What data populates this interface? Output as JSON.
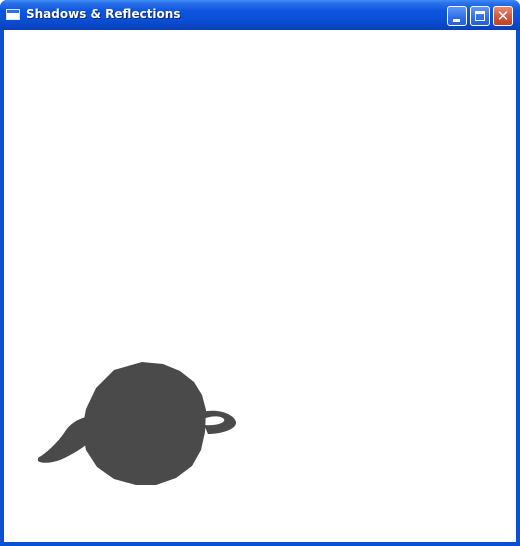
{
  "window": {
    "title": "Shadows & Reflections",
    "controls": {
      "minimize": "minimize-icon",
      "maximize": "maximize-icon",
      "close": "close-icon"
    },
    "app_icon": "window-icon"
  },
  "scene": {
    "background_color": "#ffffff",
    "object": "teapot-shadow",
    "shadow_color": "#4a4a4a"
  },
  "theme": {
    "titlebar_color": "#0a4fd6",
    "close_button_color": "#d4563a"
  }
}
